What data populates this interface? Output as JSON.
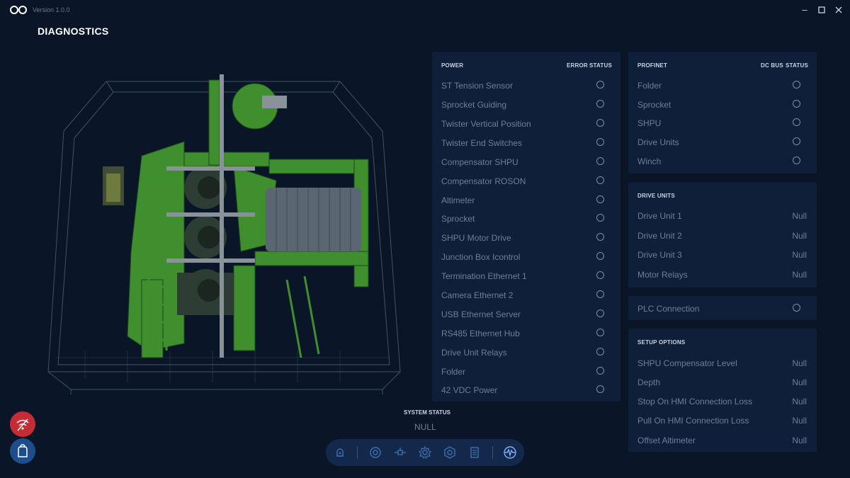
{
  "app": {
    "version": "Version 1.0.0"
  },
  "page": {
    "title": "DIAGNOSTICS"
  },
  "power": {
    "heading": "POWER",
    "col_error": "ERROR",
    "col_status": "STATUS",
    "items": [
      "ST Tension Sensor",
      "Sprocket Guiding",
      "Twister Vertical Position",
      "Twister End Switches",
      "Compensator SHPU",
      "Compensator ROSON",
      "Altimeter",
      "Sprocket",
      "SHPU Motor Drive",
      "Junction Box Icontrol",
      "Termination Ethernet 1",
      "Camera Ethernet 2",
      "USB Ethernet Server",
      "RS485 Ethernet Hub",
      "Drive Unit Relays",
      "Folder",
      "42 VDC Power"
    ]
  },
  "profinet": {
    "heading": "PROFINET",
    "col_dcbus": "DC BUS",
    "col_status": "STATUS",
    "items": [
      "Folder",
      "Sprocket",
      "SHPU",
      "Drive Units",
      "Winch"
    ]
  },
  "drive_units": {
    "heading": "DRIVE UNITS",
    "items": [
      {
        "label": "Drive Unit 1",
        "value": "Null"
      },
      {
        "label": "Drive Unit 2",
        "value": "Null"
      },
      {
        "label": "Drive Unit 3",
        "value": "Null"
      },
      {
        "label": "Motor Relays",
        "value": "Null"
      }
    ]
  },
  "plc": {
    "label": "PLC Connection"
  },
  "setup_options": {
    "heading": "SETUP OPTIONS",
    "items": [
      {
        "label": "SHPU Compensator Level",
        "value": "Null"
      },
      {
        "label": "Depth",
        "value": "Null"
      },
      {
        "label": "Stop On HMI Connection Loss",
        "value": "Null"
      },
      {
        "label": "Pull On HMI Connection Loss",
        "value": "Null"
      },
      {
        "label": "Offset Altimeter",
        "value": "Null"
      }
    ]
  },
  "system_status": {
    "label": "SYSTEM STATUS",
    "value": "NULL"
  },
  "nav": {
    "icons": [
      "bell-icon",
      "target-icon",
      "drone-icon",
      "gear-icon",
      "settings-alt-icon",
      "document-icon",
      "waveform-icon"
    ]
  },
  "side": {
    "icons": [
      "wifi-off-icon",
      "bag-icon"
    ]
  },
  "colors": {
    "background": "#0a1628",
    "panel": "#0f1f3a",
    "accent_red": "#c42d33",
    "accent_blue": "#1f4d8c",
    "machine_green": "#3f8f2f"
  }
}
